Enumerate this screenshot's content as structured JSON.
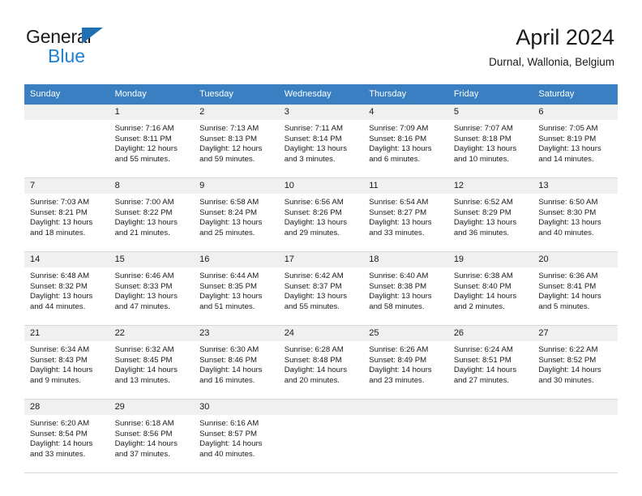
{
  "brand": {
    "name_top": "General",
    "name_bottom": "Blue",
    "triangle_color": "#1f6fb5",
    "blue_color": "#1f7fd0"
  },
  "header": {
    "title": "April 2024",
    "subtitle": "Durnal, Wallonia, Belgium"
  },
  "theme": {
    "header_row_bg": "#3a7fc1",
    "daynum_bg": "#f0f0f0",
    "grid_line": "#d8d8d8",
    "text": "#1a1a1a"
  },
  "calendar": {
    "weekday_headers": [
      "Sunday",
      "Monday",
      "Tuesday",
      "Wednesday",
      "Thursday",
      "Friday",
      "Saturday"
    ],
    "labels": {
      "sunrise": "Sunrise:",
      "sunset": "Sunset:",
      "daylight": "Daylight:"
    },
    "weeks": [
      [
        {
          "day": "",
          "empty": true
        },
        {
          "day": "1",
          "sunrise": "Sunrise: 7:16 AM",
          "sunset": "Sunset: 8:11 PM",
          "daylight_1": "Daylight: 12 hours",
          "daylight_2": "and 55 minutes."
        },
        {
          "day": "2",
          "sunrise": "Sunrise: 7:13 AM",
          "sunset": "Sunset: 8:13 PM",
          "daylight_1": "Daylight: 12 hours",
          "daylight_2": "and 59 minutes."
        },
        {
          "day": "3",
          "sunrise": "Sunrise: 7:11 AM",
          "sunset": "Sunset: 8:14 PM",
          "daylight_1": "Daylight: 13 hours",
          "daylight_2": "and 3 minutes."
        },
        {
          "day": "4",
          "sunrise": "Sunrise: 7:09 AM",
          "sunset": "Sunset: 8:16 PM",
          "daylight_1": "Daylight: 13 hours",
          "daylight_2": "and 6 minutes."
        },
        {
          "day": "5",
          "sunrise": "Sunrise: 7:07 AM",
          "sunset": "Sunset: 8:18 PM",
          "daylight_1": "Daylight: 13 hours",
          "daylight_2": "and 10 minutes."
        },
        {
          "day": "6",
          "sunrise": "Sunrise: 7:05 AM",
          "sunset": "Sunset: 8:19 PM",
          "daylight_1": "Daylight: 13 hours",
          "daylight_2": "and 14 minutes."
        }
      ],
      [
        {
          "day": "7",
          "sunrise": "Sunrise: 7:03 AM",
          "sunset": "Sunset: 8:21 PM",
          "daylight_1": "Daylight: 13 hours",
          "daylight_2": "and 18 minutes."
        },
        {
          "day": "8",
          "sunrise": "Sunrise: 7:00 AM",
          "sunset": "Sunset: 8:22 PM",
          "daylight_1": "Daylight: 13 hours",
          "daylight_2": "and 21 minutes."
        },
        {
          "day": "9",
          "sunrise": "Sunrise: 6:58 AM",
          "sunset": "Sunset: 8:24 PM",
          "daylight_1": "Daylight: 13 hours",
          "daylight_2": "and 25 minutes."
        },
        {
          "day": "10",
          "sunrise": "Sunrise: 6:56 AM",
          "sunset": "Sunset: 8:26 PM",
          "daylight_1": "Daylight: 13 hours",
          "daylight_2": "and 29 minutes."
        },
        {
          "day": "11",
          "sunrise": "Sunrise: 6:54 AM",
          "sunset": "Sunset: 8:27 PM",
          "daylight_1": "Daylight: 13 hours",
          "daylight_2": "and 33 minutes."
        },
        {
          "day": "12",
          "sunrise": "Sunrise: 6:52 AM",
          "sunset": "Sunset: 8:29 PM",
          "daylight_1": "Daylight: 13 hours",
          "daylight_2": "and 36 minutes."
        },
        {
          "day": "13",
          "sunrise": "Sunrise: 6:50 AM",
          "sunset": "Sunset: 8:30 PM",
          "daylight_1": "Daylight: 13 hours",
          "daylight_2": "and 40 minutes."
        }
      ],
      [
        {
          "day": "14",
          "sunrise": "Sunrise: 6:48 AM",
          "sunset": "Sunset: 8:32 PM",
          "daylight_1": "Daylight: 13 hours",
          "daylight_2": "and 44 minutes."
        },
        {
          "day": "15",
          "sunrise": "Sunrise: 6:46 AM",
          "sunset": "Sunset: 8:33 PM",
          "daylight_1": "Daylight: 13 hours",
          "daylight_2": "and 47 minutes."
        },
        {
          "day": "16",
          "sunrise": "Sunrise: 6:44 AM",
          "sunset": "Sunset: 8:35 PM",
          "daylight_1": "Daylight: 13 hours",
          "daylight_2": "and 51 minutes."
        },
        {
          "day": "17",
          "sunrise": "Sunrise: 6:42 AM",
          "sunset": "Sunset: 8:37 PM",
          "daylight_1": "Daylight: 13 hours",
          "daylight_2": "and 55 minutes."
        },
        {
          "day": "18",
          "sunrise": "Sunrise: 6:40 AM",
          "sunset": "Sunset: 8:38 PM",
          "daylight_1": "Daylight: 13 hours",
          "daylight_2": "and 58 minutes."
        },
        {
          "day": "19",
          "sunrise": "Sunrise: 6:38 AM",
          "sunset": "Sunset: 8:40 PM",
          "daylight_1": "Daylight: 14 hours",
          "daylight_2": "and 2 minutes."
        },
        {
          "day": "20",
          "sunrise": "Sunrise: 6:36 AM",
          "sunset": "Sunset: 8:41 PM",
          "daylight_1": "Daylight: 14 hours",
          "daylight_2": "and 5 minutes."
        }
      ],
      [
        {
          "day": "21",
          "sunrise": "Sunrise: 6:34 AM",
          "sunset": "Sunset: 8:43 PM",
          "daylight_1": "Daylight: 14 hours",
          "daylight_2": "and 9 minutes."
        },
        {
          "day": "22",
          "sunrise": "Sunrise: 6:32 AM",
          "sunset": "Sunset: 8:45 PM",
          "daylight_1": "Daylight: 14 hours",
          "daylight_2": "and 13 minutes."
        },
        {
          "day": "23",
          "sunrise": "Sunrise: 6:30 AM",
          "sunset": "Sunset: 8:46 PM",
          "daylight_1": "Daylight: 14 hours",
          "daylight_2": "and 16 minutes."
        },
        {
          "day": "24",
          "sunrise": "Sunrise: 6:28 AM",
          "sunset": "Sunset: 8:48 PM",
          "daylight_1": "Daylight: 14 hours",
          "daylight_2": "and 20 minutes."
        },
        {
          "day": "25",
          "sunrise": "Sunrise: 6:26 AM",
          "sunset": "Sunset: 8:49 PM",
          "daylight_1": "Daylight: 14 hours",
          "daylight_2": "and 23 minutes."
        },
        {
          "day": "26",
          "sunrise": "Sunrise: 6:24 AM",
          "sunset": "Sunset: 8:51 PM",
          "daylight_1": "Daylight: 14 hours",
          "daylight_2": "and 27 minutes."
        },
        {
          "day": "27",
          "sunrise": "Sunrise: 6:22 AM",
          "sunset": "Sunset: 8:52 PM",
          "daylight_1": "Daylight: 14 hours",
          "daylight_2": "and 30 minutes."
        }
      ],
      [
        {
          "day": "28",
          "sunrise": "Sunrise: 6:20 AM",
          "sunset": "Sunset: 8:54 PM",
          "daylight_1": "Daylight: 14 hours",
          "daylight_2": "and 33 minutes."
        },
        {
          "day": "29",
          "sunrise": "Sunrise: 6:18 AM",
          "sunset": "Sunset: 8:56 PM",
          "daylight_1": "Daylight: 14 hours",
          "daylight_2": "and 37 minutes."
        },
        {
          "day": "30",
          "sunrise": "Sunrise: 6:16 AM",
          "sunset": "Sunset: 8:57 PM",
          "daylight_1": "Daylight: 14 hours",
          "daylight_2": "and 40 minutes."
        },
        {
          "day": "",
          "empty": true
        },
        {
          "day": "",
          "empty": true
        },
        {
          "day": "",
          "empty": true
        },
        {
          "day": "",
          "empty": true
        }
      ]
    ]
  }
}
